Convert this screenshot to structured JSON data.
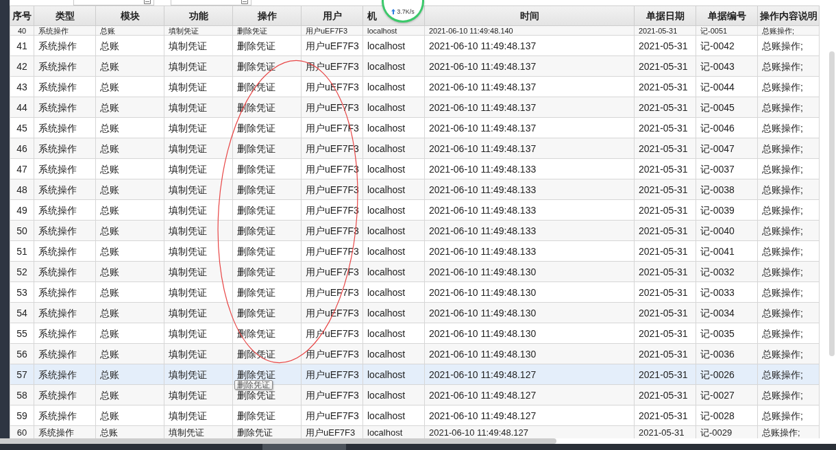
{
  "filter_bar": {
    "fields": [
      {
        "kind": "date"
      },
      {
        "kind": "date"
      }
    ]
  },
  "network_widget": {
    "speed": "3.7K/s"
  },
  "table": {
    "columns": [
      "序号",
      "类型",
      "模块",
      "功能",
      "操作",
      "用户",
      "机",
      "时间",
      "单据日期",
      "单据编号",
      "操作内容说明"
    ],
    "rows": [
      {
        "cells": [
          "40",
          "系统操作",
          "总账",
          "填制凭证",
          "删除凭证",
          "用户uEF7F3",
          "localhost",
          "2021-06-10 11:49:48.140",
          "2021-05-31",
          "记-0051",
          "总账操作;"
        ],
        "selected": false
      },
      {
        "cells": [
          "41",
          "系统操作",
          "总账",
          "填制凭证",
          "删除凭证",
          "用户uEF7F3",
          "localhost",
          "2021-06-10 11:49:48.137",
          "2021-05-31",
          "记-0042",
          "总账操作;"
        ],
        "selected": false
      },
      {
        "cells": [
          "42",
          "系统操作",
          "总账",
          "填制凭证",
          "删除凭证",
          "用户uEF7F3",
          "localhost",
          "2021-06-10 11:49:48.137",
          "2021-05-31",
          "记-0043",
          "总账操作;"
        ],
        "selected": false
      },
      {
        "cells": [
          "43",
          "系统操作",
          "总账",
          "填制凭证",
          "删除凭证",
          "用户uEF7F3",
          "localhost",
          "2021-06-10 11:49:48.137",
          "2021-05-31",
          "记-0044",
          "总账操作;"
        ],
        "selected": false
      },
      {
        "cells": [
          "44",
          "系统操作",
          "总账",
          "填制凭证",
          "删除凭证",
          "用户uEF7F3",
          "localhost",
          "2021-06-10 11:49:48.137",
          "2021-05-31",
          "记-0045",
          "总账操作;"
        ],
        "selected": false
      },
      {
        "cells": [
          "45",
          "系统操作",
          "总账",
          "填制凭证",
          "删除凭证",
          "用户uEF7F3",
          "localhost",
          "2021-06-10 11:49:48.137",
          "2021-05-31",
          "记-0046",
          "总账操作;"
        ],
        "selected": false
      },
      {
        "cells": [
          "46",
          "系统操作",
          "总账",
          "填制凭证",
          "删除凭证",
          "用户uEF7F3",
          "localhost",
          "2021-06-10 11:49:48.137",
          "2021-05-31",
          "记-0047",
          "总账操作;"
        ],
        "selected": false
      },
      {
        "cells": [
          "47",
          "系统操作",
          "总账",
          "填制凭证",
          "删除凭证",
          "用户uEF7F3",
          "localhost",
          "2021-06-10 11:49:48.133",
          "2021-05-31",
          "记-0037",
          "总账操作;"
        ],
        "selected": false
      },
      {
        "cells": [
          "48",
          "系统操作",
          "总账",
          "填制凭证",
          "删除凭证",
          "用户uEF7F3",
          "localhost",
          "2021-06-10 11:49:48.133",
          "2021-05-31",
          "记-0038",
          "总账操作;"
        ],
        "selected": false
      },
      {
        "cells": [
          "49",
          "系统操作",
          "总账",
          "填制凭证",
          "删除凭证",
          "用户uEF7F3",
          "localhost",
          "2021-06-10 11:49:48.133",
          "2021-05-31",
          "记-0039",
          "总账操作;"
        ],
        "selected": false
      },
      {
        "cells": [
          "50",
          "系统操作",
          "总账",
          "填制凭证",
          "删除凭证",
          "用户uEF7F3",
          "localhost",
          "2021-06-10 11:49:48.133",
          "2021-05-31",
          "记-0040",
          "总账操作;"
        ],
        "selected": false
      },
      {
        "cells": [
          "51",
          "系统操作",
          "总账",
          "填制凭证",
          "删除凭证",
          "用户uEF7F3",
          "localhost",
          "2021-06-10 11:49:48.133",
          "2021-05-31",
          "记-0041",
          "总账操作;"
        ],
        "selected": false
      },
      {
        "cells": [
          "52",
          "系统操作",
          "总账",
          "填制凭证",
          "删除凭证",
          "用户uEF7F3",
          "localhost",
          "2021-06-10 11:49:48.130",
          "2021-05-31",
          "记-0032",
          "总账操作;"
        ],
        "selected": false
      },
      {
        "cells": [
          "53",
          "系统操作",
          "总账",
          "填制凭证",
          "删除凭证",
          "用户uEF7F3",
          "localhost",
          "2021-06-10 11:49:48.130",
          "2021-05-31",
          "记-0033",
          "总账操作;"
        ],
        "selected": false
      },
      {
        "cells": [
          "54",
          "系统操作",
          "总账",
          "填制凭证",
          "删除凭证",
          "用户uEF7F3",
          "localhost",
          "2021-06-10 11:49:48.130",
          "2021-05-31",
          "记-0034",
          "总账操作;"
        ],
        "selected": false
      },
      {
        "cells": [
          "55",
          "系统操作",
          "总账",
          "填制凭证",
          "删除凭证",
          "用户uEF7F3",
          "localhost",
          "2021-06-10 11:49:48.130",
          "2021-05-31",
          "记-0035",
          "总账操作;"
        ],
        "selected": false
      },
      {
        "cells": [
          "56",
          "系统操作",
          "总账",
          "填制凭证",
          "删除凭证",
          "用户uEF7F3",
          "localhost",
          "2021-06-10 11:49:48.130",
          "2021-05-31",
          "记-0036",
          "总账操作;"
        ],
        "selected": false
      },
      {
        "cells": [
          "57",
          "系统操作",
          "总账",
          "填制凭证",
          "删除凭证",
          "用户uEF7F3",
          "localhost",
          "2021-06-10 11:49:48.127",
          "2021-05-31",
          "记-0026",
          "总账操作;"
        ],
        "selected": true
      },
      {
        "cells": [
          "58",
          "系统操作",
          "总账",
          "填制凭证",
          "删除凭证",
          "用户uEF7F3",
          "localhost",
          "2021-06-10 11:49:48.127",
          "2021-05-31",
          "记-0027",
          "总账操作;"
        ],
        "selected": false
      },
      {
        "cells": [
          "59",
          "系统操作",
          "总账",
          "填制凭证",
          "删除凭证",
          "用户uEF7F3",
          "localhost",
          "2021-06-10 11:49:48.127",
          "2021-05-31",
          "记-0028",
          "总账操作;"
        ],
        "selected": false
      },
      {
        "cells": [
          "60",
          "系统操作",
          "总账",
          "填制凭证",
          "删除凭证",
          "用户uEF7F3",
          "localhost",
          "2021-06-10 11:49:48.127",
          "2021-05-31",
          "记-0029",
          "总账操作;"
        ],
        "selected": false
      }
    ]
  },
  "tooltip": {
    "text": "删除凭证"
  },
  "annotations": [
    {
      "kind": "ellipse"
    }
  ]
}
